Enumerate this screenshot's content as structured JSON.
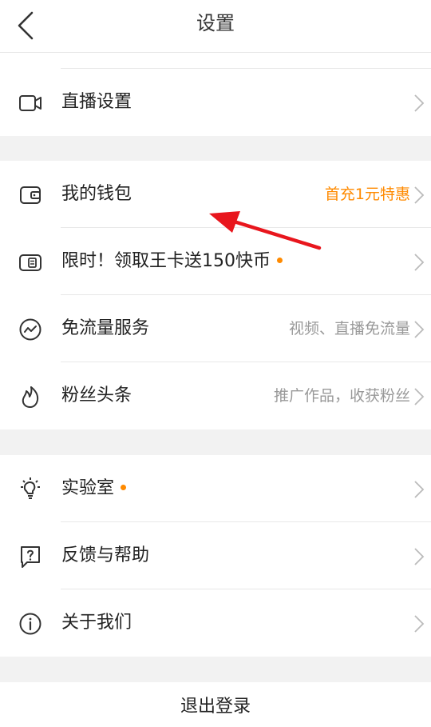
{
  "header": {
    "title": "设置",
    "back_icon": "chevron-left-icon"
  },
  "groups": [
    {
      "items": [
        {
          "label": "直播设置",
          "icon": "video-camera-icon",
          "right_text": ""
        }
      ]
    },
    {
      "items": [
        {
          "label": "我的钱包",
          "icon": "wallet-icon",
          "right_text": "首充1元特惠",
          "right_color": "#ff8a00"
        },
        {
          "label": "限时！领取王卡送150快币",
          "icon": "card-icon",
          "right_text": "",
          "badge_dot": true
        },
        {
          "label": "免流量服务",
          "icon": "data-wave-icon",
          "right_text": "视频、直播免流量"
        },
        {
          "label": "粉丝头条",
          "icon": "flame-icon",
          "right_text": "推广作品，收获粉丝"
        }
      ]
    },
    {
      "items": [
        {
          "label": "实验室",
          "icon": "lightbulb-icon",
          "right_text": "",
          "badge_dot": true
        },
        {
          "label": "反馈与帮助",
          "icon": "help-bubble-icon",
          "right_text": ""
        },
        {
          "label": "关于我们",
          "icon": "info-icon",
          "right_text": ""
        }
      ]
    }
  ],
  "logout_label": "退出登录",
  "colors": {
    "accent": "#ff8a00",
    "annotation_arrow": "#e8161d",
    "background": "#f2f2f2"
  }
}
